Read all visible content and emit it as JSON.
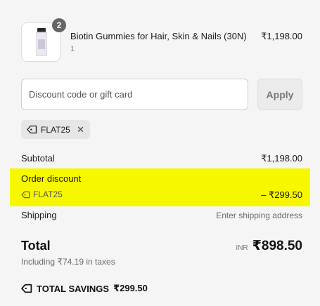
{
  "product": {
    "name": "Biotin Gummies for Hair, Skin & Nails (30N)",
    "variant": "1",
    "price": "₹1,198.00",
    "quantity_badge": "2",
    "image_icon": "supplement-bottle-icon"
  },
  "discount": {
    "placeholder": "Discount code or gift card",
    "value": "",
    "apply_label": "Apply",
    "applied_code": "FLAT25"
  },
  "summary": {
    "subtotal_label": "Subtotal",
    "subtotal_value": "₹1,198.00",
    "order_discount_label": "Order discount",
    "discount_code": "FLAT25",
    "discount_value": "– ₹299.50",
    "shipping_label": "Shipping",
    "shipping_value": "Enter shipping address",
    "total_label": "Total",
    "currency": "INR",
    "total_value": "₹898.50",
    "tax_note": "Including ₹74.19 in taxes",
    "savings_label": "TOTAL SAVINGS",
    "savings_value": "₹299.50"
  },
  "colors": {
    "highlight": "#f7f700",
    "badge": "#666666",
    "background": "#f5f5f5"
  }
}
